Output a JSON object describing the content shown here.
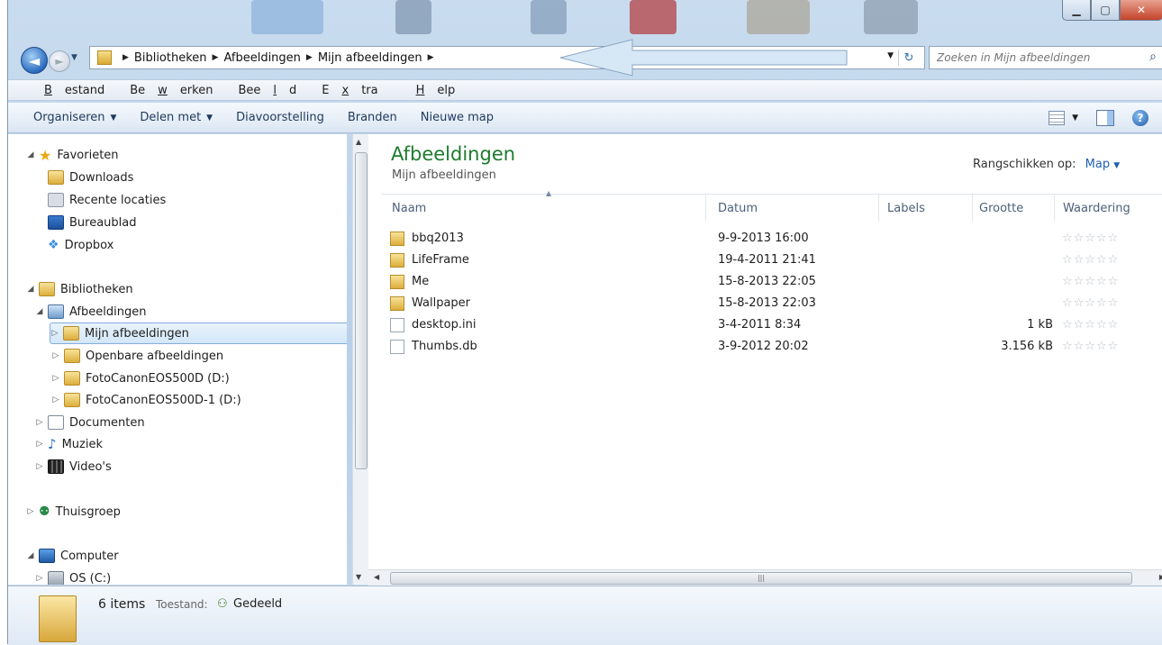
{
  "navigation": {
    "breadcrumbs": [
      "Bibliotheken",
      "Afbeeldingen",
      "Mijn afbeeldingen"
    ],
    "search_placeholder": "Zoeken in Mijn afbeeldingen"
  },
  "menu": [
    {
      "pre": "",
      "u": "B",
      "post": "estand"
    },
    {
      "pre": "Be",
      "u": "w",
      "post": "erken"
    },
    {
      "pre": "Bee",
      "u": "l",
      "post": "d"
    },
    {
      "pre": "E",
      "u": "x",
      "post": "tra"
    },
    {
      "pre": "",
      "u": "H",
      "post": "elp"
    }
  ],
  "commands": {
    "organize": "Organiseren",
    "share": "Delen met",
    "slideshow": "Diavoorstelling",
    "burn": "Branden",
    "new_folder": "Nieuwe map"
  },
  "tree": {
    "favorites": "Favorieten",
    "downloads": "Downloads",
    "recent": "Recente locaties",
    "desktop": "Bureaublad",
    "dropbox": "Dropbox",
    "libraries": "Bibliotheken",
    "pictures": "Afbeeldingen",
    "my_pictures": "Mijn afbeeldingen",
    "public_pictures": "Openbare afbeeldingen",
    "canon1": "FotoCanonEOS500D (D:)",
    "canon2": "FotoCanonEOS500D-1 (D:)",
    "documents": "Documenten",
    "music": "Muziek",
    "videos": "Video's",
    "homegroup": "Thuisgroep",
    "computer": "Computer",
    "os": "OS (C:)"
  },
  "content": {
    "title": "Afbeeldingen",
    "subtitle": "Mijn afbeeldingen",
    "arrange_label": "Rangschikken op:",
    "arrange_value": "Map",
    "columns": {
      "name": "Naam",
      "date": "Datum",
      "labels": "Labels",
      "size": "Grootte",
      "rating": "Waardering"
    },
    "files": [
      {
        "name": "bbq2013",
        "date": "9-9-2013 16:00",
        "size": "",
        "type": "folder"
      },
      {
        "name": "LifeFrame",
        "date": "19-4-2011 21:41",
        "size": "",
        "type": "folder"
      },
      {
        "name": "Me",
        "date": "15-8-2013 22:05",
        "size": "",
        "type": "folder"
      },
      {
        "name": "Wallpaper",
        "date": "15-8-2013 22:03",
        "size": "",
        "type": "folder"
      },
      {
        "name": "desktop.ini",
        "date": "3-4-2011 8:34",
        "size": "1 kB",
        "type": "file"
      },
      {
        "name": "Thumbs.db",
        "date": "3-9-2012 20:02",
        "size": "3.156 kB",
        "type": "file"
      }
    ],
    "rating_stars": "☆☆☆☆☆"
  },
  "details": {
    "count": "6 items",
    "state_label": "Toestand:",
    "state_value": "Gedeeld"
  }
}
